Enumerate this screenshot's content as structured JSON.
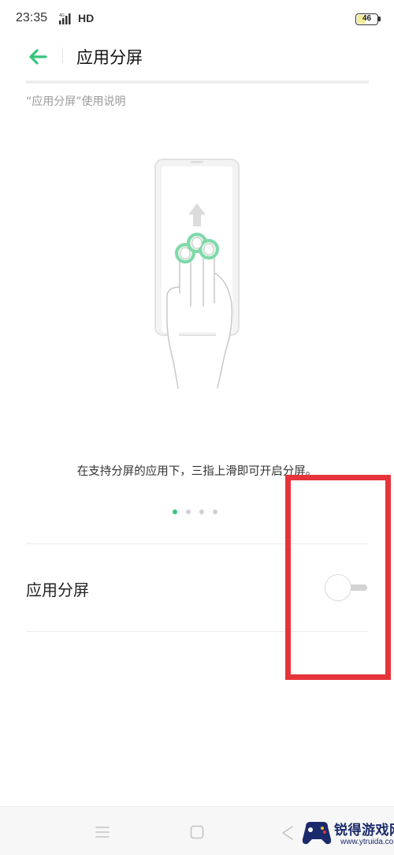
{
  "status_bar": {
    "time": "23:35",
    "network": "4G",
    "hd": "HD",
    "battery": "46",
    "battery_percent": 46
  },
  "header": {
    "back_icon": "back-arrow-icon",
    "title": "应用分屏"
  },
  "instructions_link": "“应用分屏”使用说明",
  "illustration": {
    "icon": "three-finger-swipe-up-icon",
    "caption": "在支持分屏的应用下，三指上滑即可开启分屏。"
  },
  "pager": {
    "count": 4,
    "active_index": 0
  },
  "setting": {
    "label": "应用分屏",
    "toggle_on": false
  },
  "nav_bar": {
    "icons": [
      "menu-icon",
      "home-icon",
      "back-icon"
    ]
  },
  "watermark": {
    "title": "锐得游戏网",
    "url": "www.ytruida.com"
  },
  "colors": {
    "accent": "#35c47a",
    "highlight": "#e5343a",
    "watermark": "#1b2a6b"
  }
}
